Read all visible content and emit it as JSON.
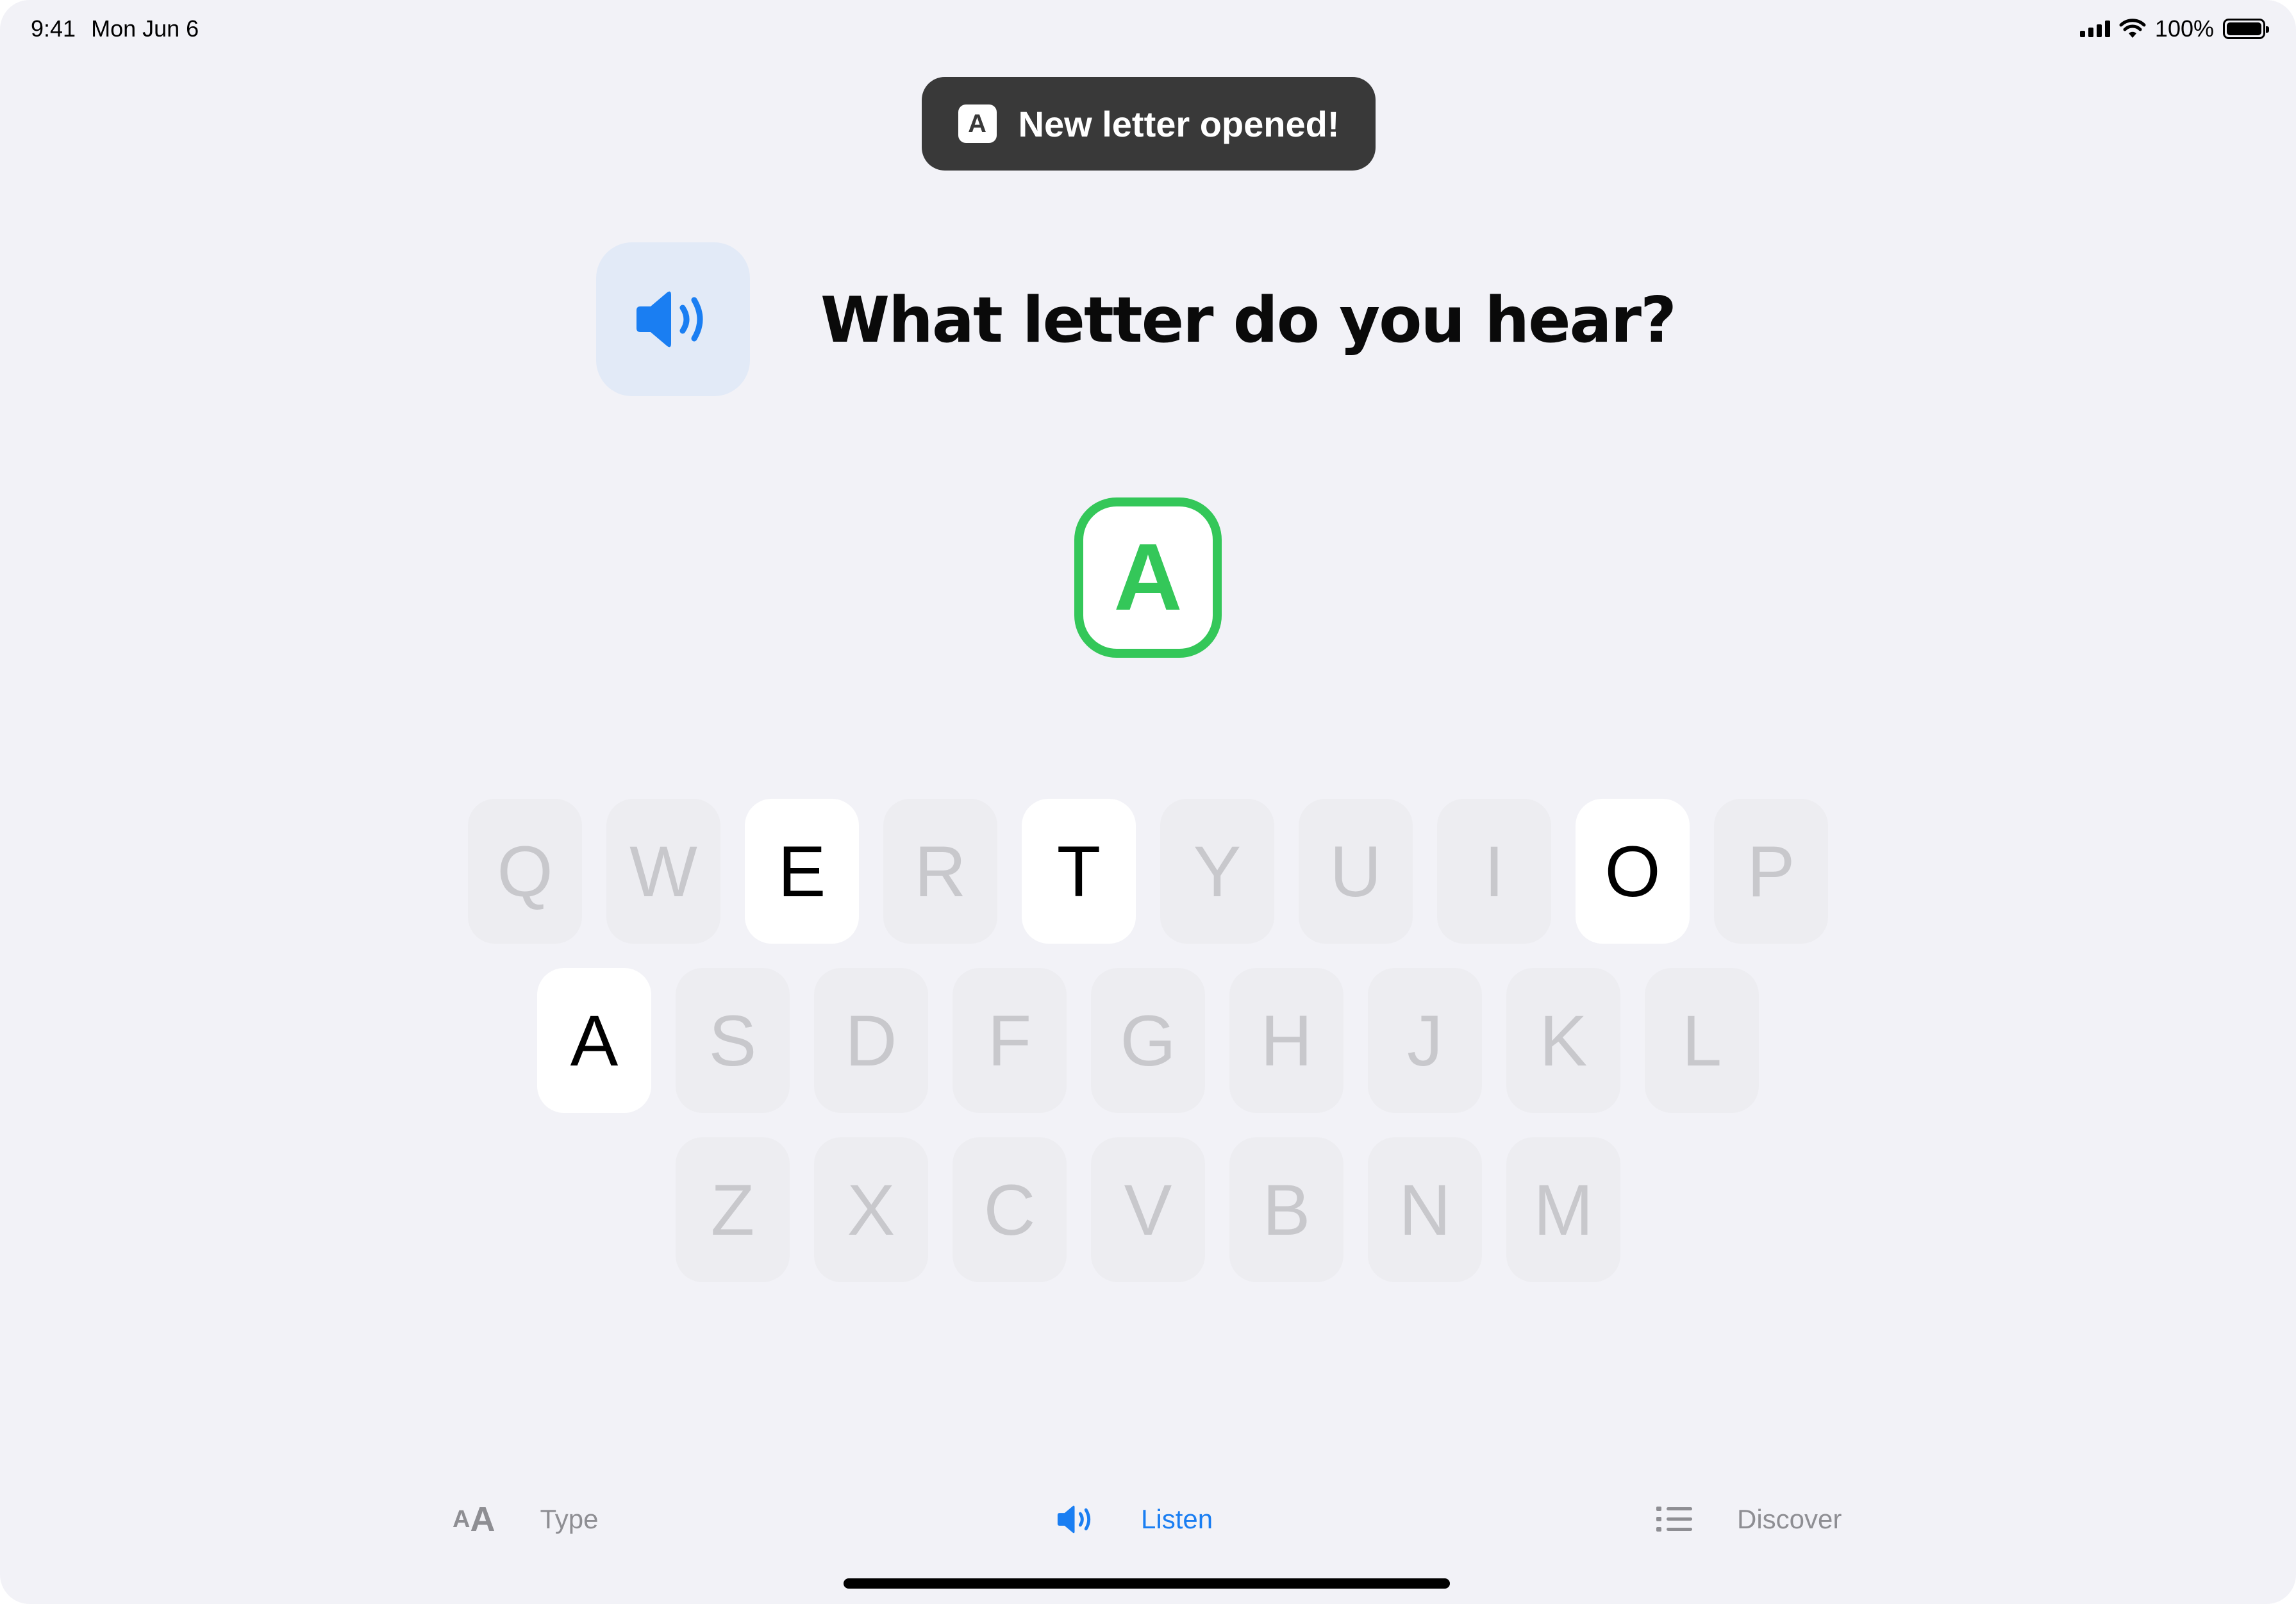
{
  "status_bar": {
    "time": "9:41",
    "date": "Mon Jun 6",
    "battery_percent": "100%",
    "battery_level": 1.0
  },
  "toast": {
    "icon_letter": "A",
    "message": "New letter opened!"
  },
  "prompt": {
    "question": "What letter do you hear?",
    "speaker_icon": "speaker-wave-icon"
  },
  "answer": {
    "letter": "A",
    "state": "correct",
    "color": "#34c759"
  },
  "keyboard": {
    "rows": [
      [
        "Q",
        "W",
        "E",
        "R",
        "T",
        "Y",
        "U",
        "I",
        "O",
        "P"
      ],
      [
        "A",
        "S",
        "D",
        "F",
        "G",
        "H",
        "J",
        "K",
        "L"
      ],
      [
        "Z",
        "X",
        "C",
        "V",
        "B",
        "N",
        "M"
      ]
    ],
    "unlocked": [
      "E",
      "T",
      "O",
      "A"
    ]
  },
  "tabs": [
    {
      "label": "Type",
      "icon": "text-size-icon",
      "active": false
    },
    {
      "label": "Listen",
      "icon": "speaker-icon",
      "active": true
    },
    {
      "label": "Discover",
      "icon": "list-icon",
      "active": false
    }
  ],
  "colors": {
    "accent": "#1a7ef2",
    "success": "#34c759",
    "background": "#f2f2f7",
    "toast_bg": "#393939"
  }
}
